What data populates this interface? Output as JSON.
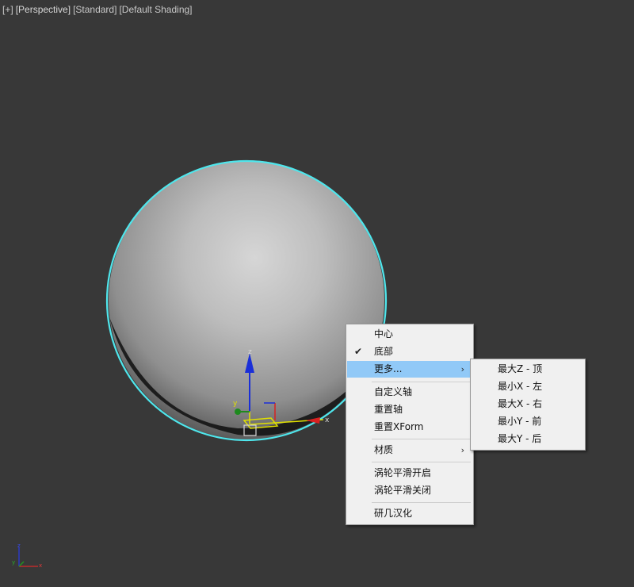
{
  "viewport": {
    "labels": [
      "[+]",
      "[Perspective]",
      "[Standard]",
      "[Default Shading]"
    ]
  },
  "gizmo": {
    "z_label": "z",
    "y_label": "y",
    "x_label": "x"
  },
  "axis_tripod": {
    "z_label": "z",
    "x_label": "x",
    "y_label": "y"
  },
  "context_menu": {
    "items": [
      {
        "label": "中心"
      },
      {
        "label": "底部",
        "checked": true
      },
      {
        "label": "更多...",
        "submenu": true
      },
      {
        "label": "自定义轴"
      },
      {
        "label": "重置轴"
      },
      {
        "label": "重置XForm"
      },
      {
        "label": "材质",
        "submenu": true
      },
      {
        "label": "涡轮平滑开启"
      },
      {
        "label": "涡轮平滑关闭"
      },
      {
        "label": "研几汉化"
      }
    ],
    "check_glyph": "✔",
    "arrow_glyph": "›"
  },
  "submenu": {
    "items": [
      {
        "label": "最大Z - 顶"
      },
      {
        "label": "最小X - 左"
      },
      {
        "label": "最大X - 右"
      },
      {
        "label": "最小Y - 前"
      },
      {
        "label": "最大Y - 后"
      }
    ]
  },
  "colors": {
    "viewport_bg": "#383838",
    "selection_outline": "#4fe6ec",
    "menu_highlight": "#91c9f7",
    "menu_bg": "#f0f0f0"
  }
}
